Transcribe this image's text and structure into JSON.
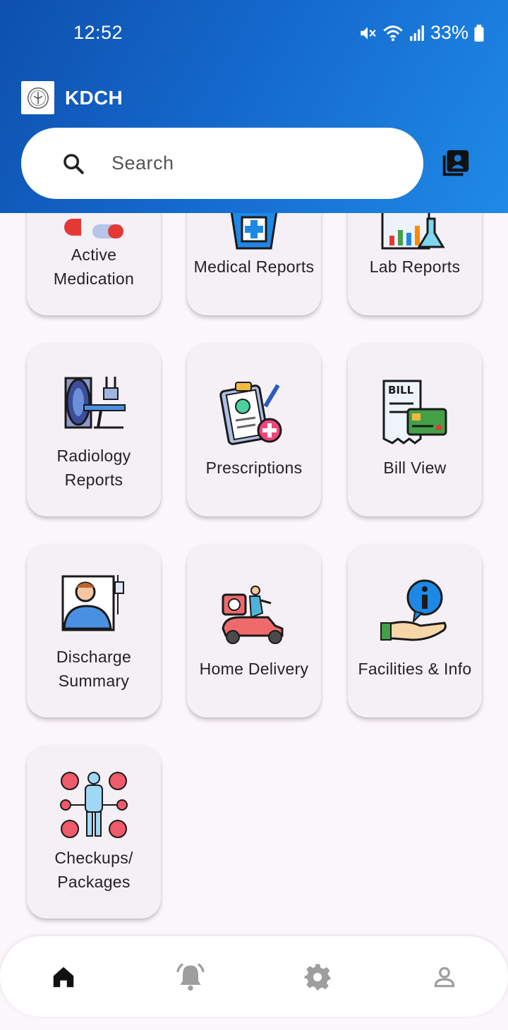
{
  "status_bar": {
    "time": "12:52",
    "battery": "33%"
  },
  "header": {
    "app_title": "KDCH"
  },
  "search": {
    "placeholder": "Search"
  },
  "tiles": [
    {
      "label": "Active\nMedication",
      "icon": "pills-icon"
    },
    {
      "label": "Medical Reports",
      "icon": "medical-kit-icon"
    },
    {
      "label": "Lab Reports",
      "icon": "lab-chart-icon"
    },
    {
      "label": "Radiology\nReports",
      "icon": "mri-scanner-icon"
    },
    {
      "label": "Prescriptions",
      "icon": "clipboard-prescription-icon"
    },
    {
      "label": "Bill View",
      "icon": "bill-card-icon"
    },
    {
      "label": "Discharge\nSummary",
      "icon": "patient-bed-icon"
    },
    {
      "label": "Home Delivery",
      "icon": "delivery-scooter-icon"
    },
    {
      "label": "Facilities & Info",
      "icon": "hand-info-icon"
    },
    {
      "label": "Checkups/\nPackages",
      "icon": "health-checkup-icon"
    }
  ],
  "bottom_nav": [
    {
      "name": "home",
      "icon": "home-icon",
      "active": true
    },
    {
      "name": "notifications",
      "icon": "bell-icon",
      "active": false
    },
    {
      "name": "settings",
      "icon": "gear-icon",
      "active": false
    },
    {
      "name": "profile",
      "icon": "person-icon",
      "active": false
    }
  ],
  "colors": {
    "header_start": "#0e50ad",
    "header_end": "#1f8ae6",
    "page_bg": "#fbf6fb",
    "tile_bg": "#f4f0f6",
    "nav_active": "#111111",
    "nav_inactive": "#9e9e9e"
  }
}
